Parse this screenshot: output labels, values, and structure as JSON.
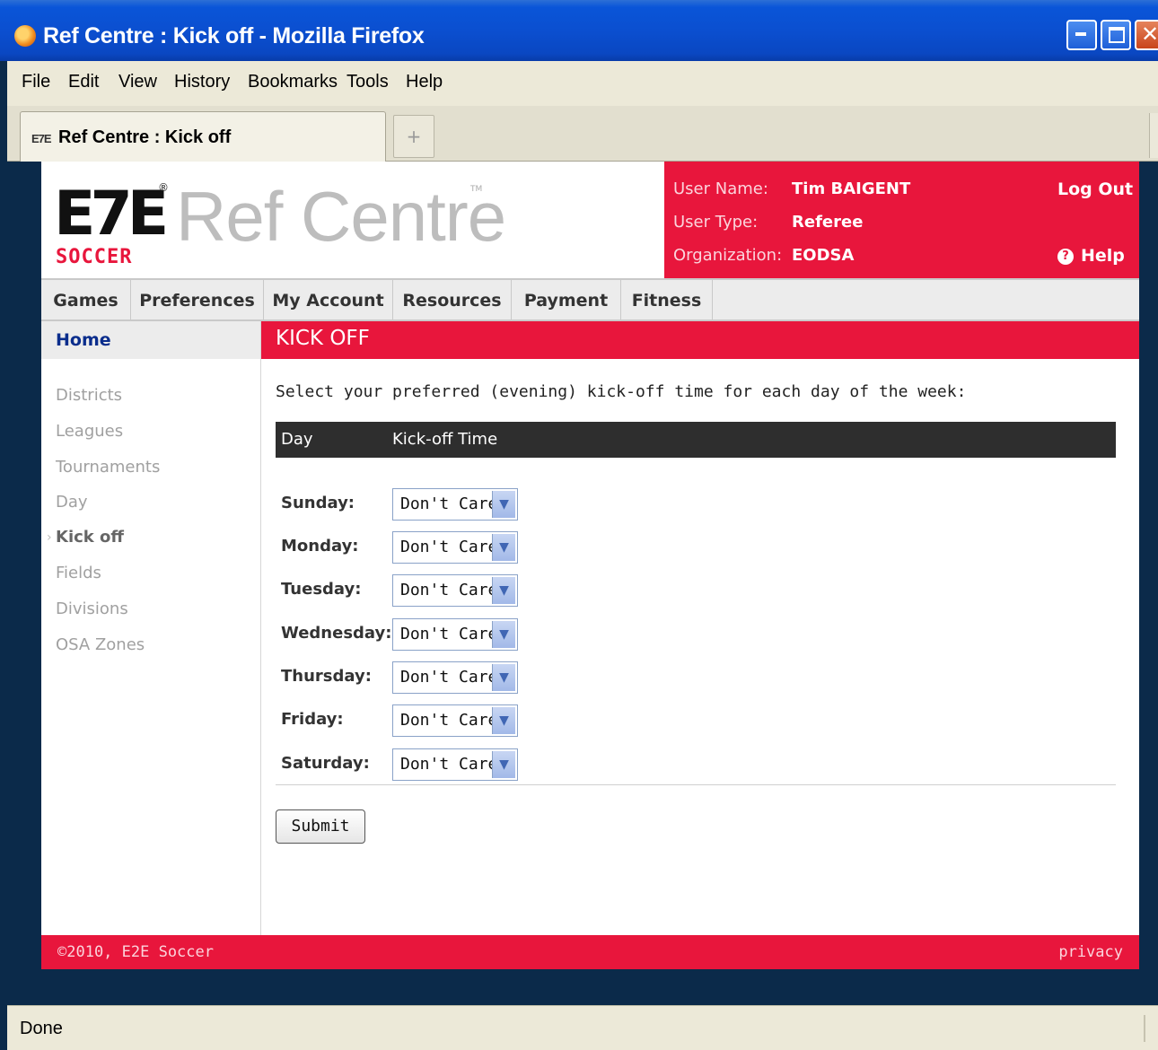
{
  "window": {
    "title": "Ref Centre : Kick off - Mozilla Firefox"
  },
  "menu": [
    "File",
    "Edit",
    "View",
    "History",
    "Bookmarks",
    "Tools",
    "Help"
  ],
  "tab": {
    "title": "Ref Centre : Kick off",
    "icon_text": "E7E",
    "new_tab_symbol": "+"
  },
  "logo": {
    "mark": "E7E",
    "mark_sub": "SOCCER",
    "reg": "®",
    "name": "Ref Centre",
    "tm": "TM"
  },
  "user": {
    "name_label": "User Name:",
    "name": "Tim BAIGENT",
    "type_label": "User Type:",
    "type": "Referee",
    "org_label": "Organization:",
    "org": "EODSA",
    "logout": "Log Out",
    "help": "Help",
    "help_icon": "?"
  },
  "nav": [
    "Games",
    "Preferences",
    "My Account",
    "Resources",
    "Payment",
    "Fitness"
  ],
  "sidebar": {
    "home": "Home",
    "links": [
      "Districts",
      "Leagues",
      "Tournaments",
      "Day",
      "Kick off",
      "Fields",
      "Divisions",
      "OSA Zones"
    ],
    "active_index": 4
  },
  "main": {
    "header": "KICK OFF",
    "instructions": "Select your preferred (evening) kick-off time for each day of the week:",
    "col_day": "Day",
    "col_time": "Kick-off Time",
    "rows": [
      {
        "day": "Sunday:",
        "value": "Don't Care"
      },
      {
        "day": "Monday:",
        "value": "Don't Care"
      },
      {
        "day": "Tuesday:",
        "value": "Don't Care"
      },
      {
        "day": "Wednesday:",
        "value": "Don't Care"
      },
      {
        "day": "Thursday:",
        "value": "Don't Care"
      },
      {
        "day": "Friday:",
        "value": "Don't Care"
      },
      {
        "day": "Saturday:",
        "value": "Don't Care"
      }
    ],
    "submit": "Submit"
  },
  "footer": {
    "copyright": "©2010, E2E Soccer",
    "privacy": "privacy"
  },
  "status": "Done",
  "colors": {
    "brand_red": "#e8163c",
    "nav_bg": "#ececec",
    "table_header": "#2e2e2e",
    "home_link": "#0a2d8c"
  }
}
